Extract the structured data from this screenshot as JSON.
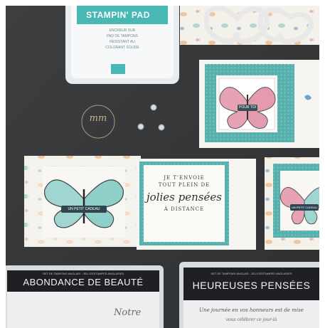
{
  "ink_pad": {
    "brand": "STAMPIN' PAD",
    "label_lines": [
      "ENCREUR SUR",
      "PAD DE TAMPONS",
      "RESISTANT AU",
      "COLORANT SOLIDE"
    ]
  },
  "watermark": {
    "initials": "mm"
  },
  "sentiment_card": {
    "line1": "JE T'ENVOIE",
    "line2": "TOUT PLEIN DE",
    "line3": "jolies pensées",
    "line4": "À DISTANCE"
  },
  "butterfly_card_left": {
    "tag": "UN PETIT CADEAU"
  },
  "butterfly_card_top_right": {
    "tag": "POUR TOI"
  },
  "butterfly_card_right": {
    "tag": "UN PETIT CADEAU"
  },
  "stamp_box_left": {
    "subtitle": "SET DE TAMPONS ANGLAIS · JEU D'ESTAMPES ANGLAISES",
    "title": "ABONDANCE DE BEAUTÉ",
    "script": "Notre"
  },
  "stamp_box_right": {
    "subtitle": "SET DE TAMPONS ANGLAIS · JEU D'ESTAMPES ANGLAISES",
    "title": "HEUREUSES PENSÉES",
    "script_line1": "Une journée en vos honneurs est de mise",
    "script_line2": "vous célébrer ce jour-là"
  },
  "colors": {
    "background": "#343638",
    "teal": "#5bb5b0",
    "pink": "#e7a3b3",
    "card_white": "#f4f3ef"
  }
}
